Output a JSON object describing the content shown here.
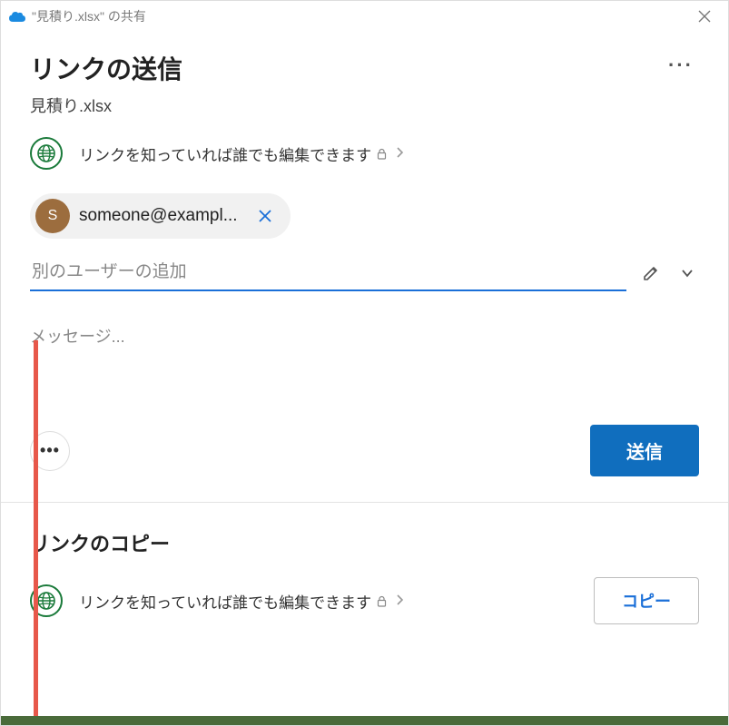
{
  "titlebar": {
    "title": "\"見積り.xlsx\" の共有"
  },
  "header": {
    "heading": "リンクの送信",
    "filename": "見積り.xlsx"
  },
  "permission": {
    "text": "リンクを知っていれば誰でも編集できます"
  },
  "recipient": {
    "initial": "S",
    "email": "someone@exampl..."
  },
  "addUser": {
    "placeholder": "別のユーザーの追加"
  },
  "message": {
    "placeholder": "メッセージ..."
  },
  "actions": {
    "send": "送信"
  },
  "copySection": {
    "heading": "リンクのコピー",
    "permissionText": "リンクを知っていれば誰でも編集できます",
    "copyButton": "コピー"
  }
}
